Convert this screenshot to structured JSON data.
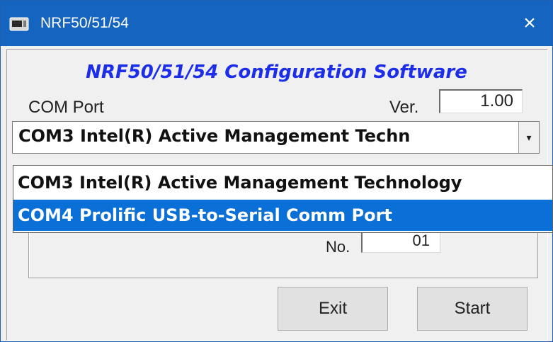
{
  "window": {
    "title": "NRF50/51/54",
    "close_glyph": "×",
    "icon": "app-icon"
  },
  "heading": "NRF50/51/54 Configuration Software",
  "com_port": {
    "label": "COM Port",
    "selected": "COM3 Intel(R) Active Management Techn",
    "options": [
      "COM3 Intel(R) Active Management Technology",
      "COM4 Prolific USB-to-Serial Comm Port"
    ],
    "highlighted_index": 1
  },
  "version": {
    "label": "Ver.",
    "value": "1.00"
  },
  "number": {
    "label": "No.",
    "value": "01"
  },
  "buttons": {
    "exit": "Exit",
    "start": "Start"
  },
  "colors": {
    "titlebar": "#1565c0",
    "heading": "#1c2ee8",
    "selection": "#0a6fd6"
  }
}
